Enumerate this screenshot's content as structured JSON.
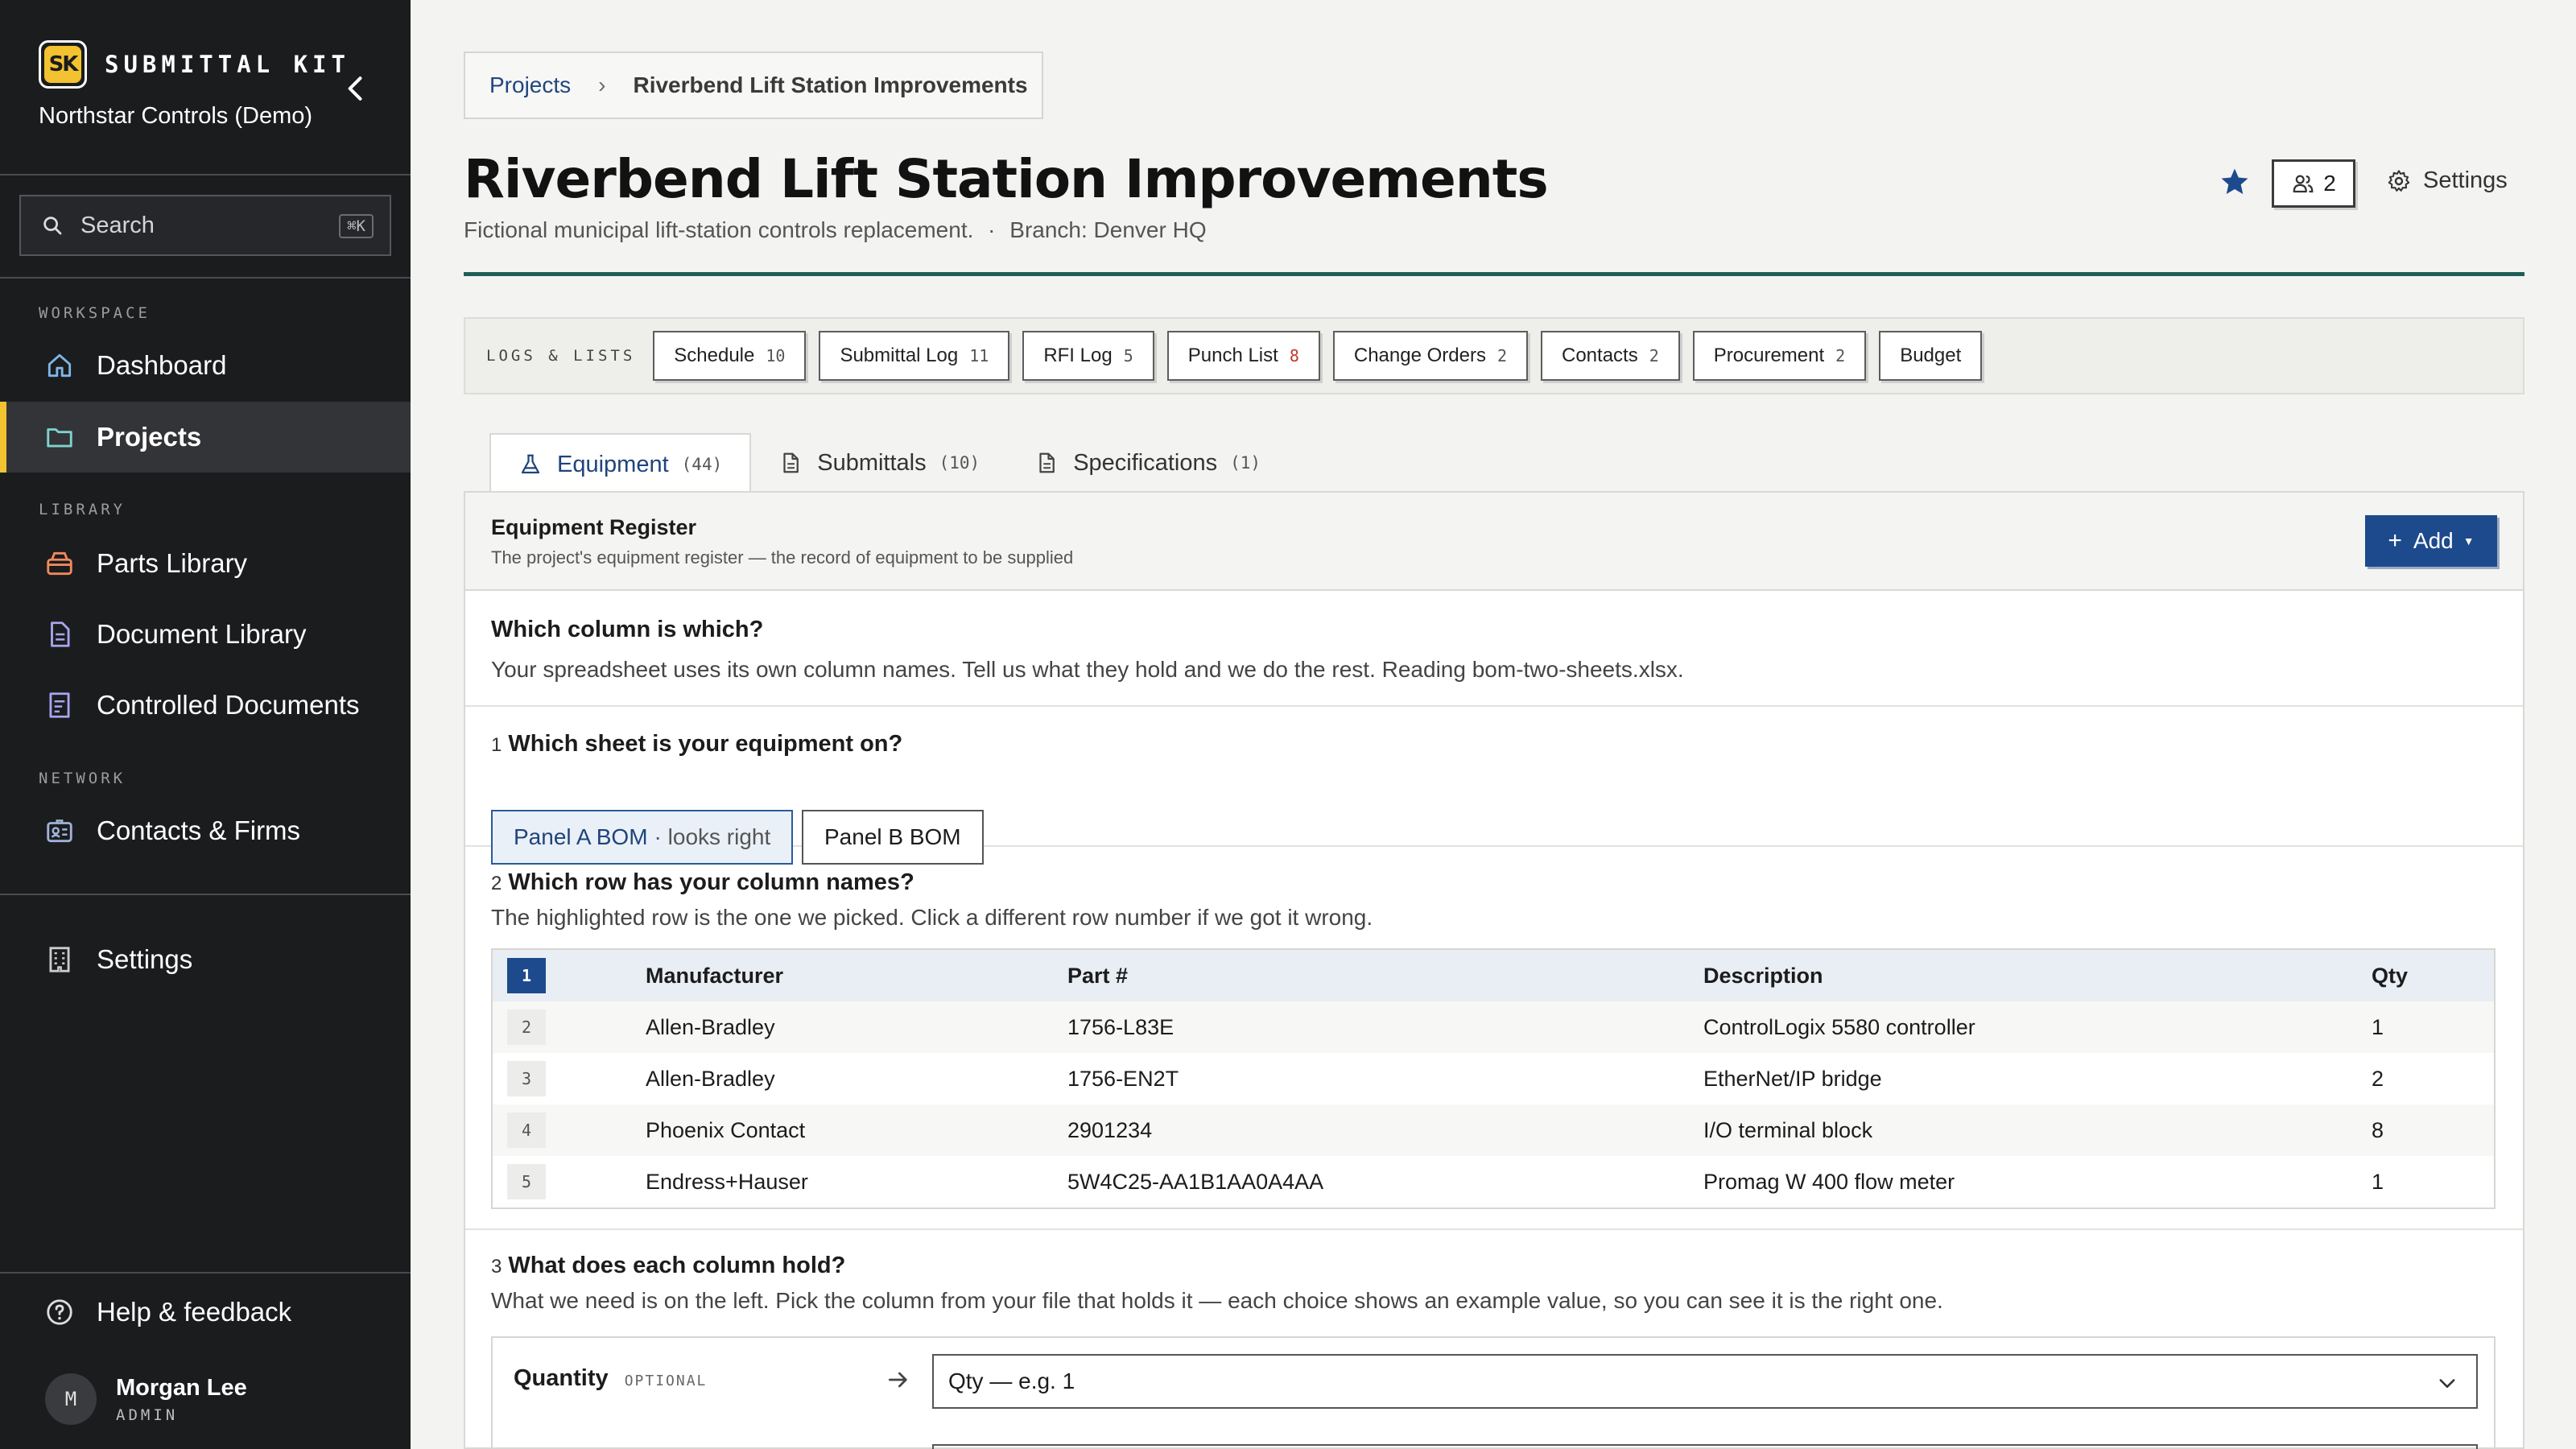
{
  "app": {
    "brand_initials": "SK",
    "brand_name": "SUBMITTAL KIT",
    "org_name": "Northstar Controls (Demo)"
  },
  "sidebar": {
    "search_label": "Search",
    "search_shortcut": "⌘K",
    "sections": {
      "workspace": "WORKSPACE",
      "library": "LIBRARY",
      "network": "NETWORK"
    },
    "items": {
      "dashboard": "Dashboard",
      "projects": "Projects",
      "parts_library": "Parts Library",
      "document_library": "Document Library",
      "controlled_documents": "Controlled Documents",
      "contacts_firms": "Contacts & Firms",
      "settings": "Settings",
      "help": "Help & feedback"
    },
    "user": {
      "initial": "M",
      "name": "Morgan Lee",
      "role": "ADMIN"
    }
  },
  "breadcrumb": {
    "root": "Projects",
    "current": "Riverbend Lift Station Improvements"
  },
  "project": {
    "title": "Riverbend Lift Station Improvements",
    "description": "Fictional municipal lift-station controls replacement.",
    "separator": "·",
    "branch": "Branch: Denver HQ",
    "members_count": "2",
    "settings_label": "Settings"
  },
  "logs": {
    "label": "LOGS & LISTS",
    "chips": [
      {
        "label": "Schedule",
        "count": "10"
      },
      {
        "label": "Submittal Log",
        "count": "11"
      },
      {
        "label": "RFI Log",
        "count": "5"
      },
      {
        "label": "Punch List",
        "count": "8"
      },
      {
        "label": "Change Orders",
        "count": "2"
      },
      {
        "label": "Contacts",
        "count": "2"
      },
      {
        "label": "Procurement",
        "count": "2"
      },
      {
        "label": "Budget",
        "count": ""
      }
    ]
  },
  "tabs": [
    {
      "label": "Equipment",
      "count": "(44)"
    },
    {
      "label": "Submittals",
      "count": "(10)"
    },
    {
      "label": "Specifications",
      "count": "(1)"
    }
  ],
  "register": {
    "title": "Equipment Register",
    "subtitle": "The project's equipment register — the record of equipment to be supplied",
    "add_label": "Add"
  },
  "wizard": {
    "title": "Which column is which?",
    "description": "Your spreadsheet uses its own column names. Tell us what they hold and we do the rest. Reading bom-two-sheets.xlsx.",
    "step1": {
      "num": "1",
      "title": "Which sheet is your equipment on?",
      "sheets": [
        {
          "name": "Panel A BOM",
          "hint": "· looks right"
        },
        {
          "name": "Panel B BOM",
          "hint": ""
        }
      ]
    },
    "step2": {
      "num": "2",
      "title": "Which row has your column names?",
      "description": "The highlighted row is the one we picked. Click a different row number if we got it wrong.",
      "rows": [
        {
          "n": "1",
          "c": [
            "Manufacturer",
            "Part #",
            "Description",
            "Qty"
          ]
        },
        {
          "n": "2",
          "c": [
            "Allen-Bradley",
            "1756-L83E",
            "ControlLogix 5580 controller",
            "1"
          ]
        },
        {
          "n": "3",
          "c": [
            "Allen-Bradley",
            "1756-EN2T",
            "EtherNet/IP bridge",
            "2"
          ]
        },
        {
          "n": "4",
          "c": [
            "Phoenix Contact",
            "2901234",
            "I/O terminal block",
            "8"
          ]
        },
        {
          "n": "5",
          "c": [
            "Endress+Hauser",
            "5W4C25-AA1B1AA0A4AA",
            "Promag W 400 flow meter",
            "1"
          ]
        }
      ]
    },
    "step3": {
      "num": "3",
      "title": "What does each column hold?",
      "description": "What we need is on the left. Pick the column from your file that holds it — each choice shows an example value, so you can see it is the right one.",
      "mapping": {
        "label": "Quantity",
        "optional": "OPTIONAL",
        "value": "Qty — e.g. 1"
      }
    }
  },
  "colors": {
    "sidebar_bg": "#1b1c1e",
    "accent_yellow": "#f2c230",
    "primary_blue": "#1d4a8c",
    "title_rule": "#1f5e58",
    "alert_red": "#c0392b"
  }
}
